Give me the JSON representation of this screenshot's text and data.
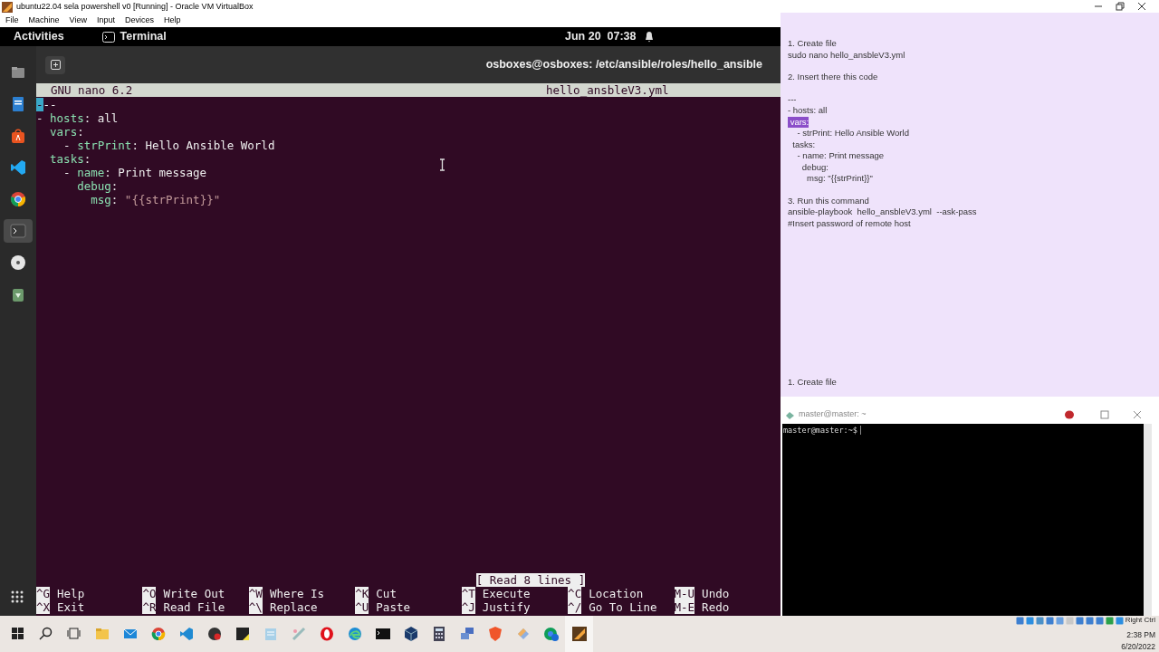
{
  "window": {
    "title": "ubuntu22.04 sela powershell v0 [Running] - Oracle VM VirtualBox",
    "menu": [
      "File",
      "Machine",
      "View",
      "Input",
      "Devices",
      "Help"
    ]
  },
  "ubuntu_bar": {
    "activities": "Activities",
    "app": "Terminal",
    "clock": "Jun 20  07:38"
  },
  "dock": [
    {
      "kind": "files",
      "selected": false
    },
    {
      "kind": "editor",
      "selected": false
    },
    {
      "kind": "store",
      "selected": false
    },
    {
      "kind": "vscode",
      "selected": false
    },
    {
      "kind": "chrome",
      "selected": false
    },
    {
      "kind": "terminal",
      "selected": true
    },
    {
      "kind": "disc",
      "selected": false
    },
    {
      "kind": "trash",
      "selected": false
    }
  ],
  "terminal": {
    "title": "osboxes@osboxes: /etc/ansible/roles/hello_ansible",
    "nano": {
      "version": "GNU nano 6.2",
      "filename": "hello_ansbleV3.yml",
      "status": "[ Read 8 lines ]",
      "lines": [
        [
          {
            "kind": "cursor",
            "text": "-"
          },
          {
            "kind": "plain",
            "text": "--"
          }
        ],
        [
          {
            "kind": "plain",
            "text": "- "
          },
          {
            "kind": "key",
            "text": "hosts"
          },
          {
            "kind": "plain",
            "text": ": all"
          }
        ],
        [
          {
            "kind": "key",
            "text": "  vars"
          },
          {
            "kind": "plain",
            "text": ":"
          }
        ],
        [
          {
            "kind": "plain",
            "text": "    - "
          },
          {
            "kind": "key",
            "text": "strPrint"
          },
          {
            "kind": "plain",
            "text": ": Hello Ansible World"
          }
        ],
        [
          {
            "kind": "key",
            "text": "  tasks"
          },
          {
            "kind": "plain",
            "text": ":"
          }
        ],
        [
          {
            "kind": "plain",
            "text": "    - "
          },
          {
            "kind": "key",
            "text": "name"
          },
          {
            "kind": "plain",
            "text": ": Print message"
          }
        ],
        [
          {
            "kind": "key",
            "text": "      debug"
          },
          {
            "kind": "plain",
            "text": ":"
          }
        ],
        [
          {
            "kind": "key",
            "text": "        msg"
          },
          {
            "kind": "plain",
            "text": ": "
          },
          {
            "kind": "string",
            "text": "\"{{strPrint}}\""
          }
        ]
      ],
      "shortcuts": [
        [
          {
            "key": "^G",
            "label": "Help"
          },
          {
            "key": "^X",
            "label": "Exit"
          }
        ],
        [
          {
            "key": "^O",
            "label": "Write Out"
          },
          {
            "key": "^R",
            "label": "Read File"
          }
        ],
        [
          {
            "key": "^W",
            "label": "Where Is"
          },
          {
            "key": "^\\",
            "label": "Replace"
          }
        ],
        [
          {
            "key": "^K",
            "label": "Cut"
          },
          {
            "key": "^U",
            "label": "Paste"
          }
        ],
        [
          {
            "key": "^T",
            "label": "Execute"
          },
          {
            "key": "^J",
            "label": "Justify"
          }
        ],
        [
          {
            "key": "^C",
            "label": "Location"
          },
          {
            "key": "^/",
            "label": "Go To Line"
          }
        ],
        [
          {
            "key": "M-U",
            "label": "Undo"
          },
          {
            "key": "M-E",
            "label": "Redo"
          }
        ]
      ]
    }
  },
  "notes": {
    "paragraphs": [
      [
        {
          "text": "1. Create file",
          "highlighted": false
        },
        {
          "text": "sudo nano hello_ansbleV3.yml",
          "highlighted": false
        }
      ],
      [
        {
          "text": "2. Insert there this code",
          "highlighted": false
        }
      ],
      [
        {
          "text": "---",
          "highlighted": false
        },
        {
          "text": "- hosts: all",
          "highlighted": false
        },
        {
          "text": " vars:",
          "highlighted": true
        },
        {
          "text": "    - strPrint: Hello Ansible World",
          "highlighted": false
        },
        {
          "text": "  tasks:",
          "highlighted": false
        },
        {
          "text": "    - name: Print message",
          "highlighted": false
        },
        {
          "text": "      debug:",
          "highlighted": false
        },
        {
          "text": "        msg: \"{{strPrint}}\"",
          "highlighted": false
        }
      ],
      [
        {
          "text": "3. Run this command",
          "highlighted": false
        },
        {
          "text": "ansible-playbook  hello_ansbleV3.yml  --ask-pass",
          "highlighted": false
        },
        {
          "text": "#Insert password of remote host",
          "highlighted": false
        }
      ]
    ],
    "footer": "1. Create file"
  },
  "putty": {
    "title": "master@master: ~",
    "prompt": "master@master:~$"
  },
  "tray": {
    "keyboard": "Right Ctrl",
    "time": "2:38 PM",
    "date": "6/20/2022"
  }
}
